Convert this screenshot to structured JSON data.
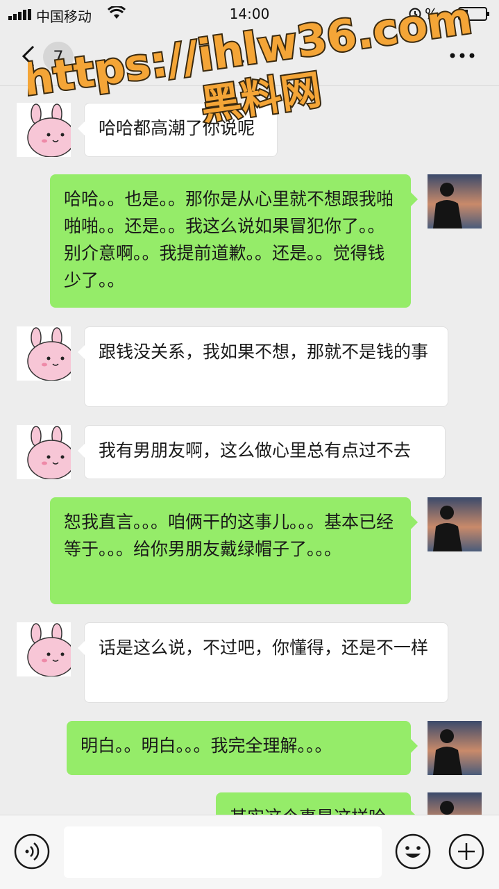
{
  "status_bar": {
    "carrier": "中国移动",
    "time": "14:00",
    "battery_percent": "%",
    "icons": [
      "signal-icon",
      "wifi-icon",
      "alarm-icon",
      "battery-icon"
    ]
  },
  "nav": {
    "unread_count": "7",
    "title": "…",
    "icons": [
      "back-arrow-icon",
      "more-icon"
    ]
  },
  "watermark": {
    "line1": "https://ihlw36.com",
    "line2": "黑料网"
  },
  "messages": [
    {
      "side": "in",
      "text": "哈哈都高潮了你说呢"
    },
    {
      "side": "out",
      "text": "哈哈。。也是。。那你是从心里就不想跟我啪啪啪。。还是。。我这么说如果冒犯你了。。别介意啊。。我提前道歉。。还是。。觉得钱少了。。"
    },
    {
      "side": "in",
      "text": "跟钱没关系，我如果不想，那就不是钱的事"
    },
    {
      "side": "in",
      "text": "我有男朋友啊，这么做心里总有点过不去"
    },
    {
      "side": "out",
      "text": "恕我直言。。。咱俩干的这事儿。。。基本已经等于。。。给你男朋友戴绿帽子了。。。"
    },
    {
      "side": "in",
      "text": "话是这么说，不过吧，你懂得，还是不一样"
    },
    {
      "side": "out",
      "text": "明白。。明白。。。我完全理解。。。"
    },
    {
      "side": "out",
      "text": "其实这个事是这样哈"
    }
  ],
  "input_bar": {
    "placeholder": "",
    "icons": [
      "voice-icon",
      "emoji-icon",
      "plus-icon"
    ]
  },
  "colors": {
    "background": "#ededed",
    "bubble_out": "#95ec69",
    "bubble_in": "#ffffff",
    "watermark_fill": "#f4a537",
    "watermark_stroke": "#3a2a10"
  }
}
